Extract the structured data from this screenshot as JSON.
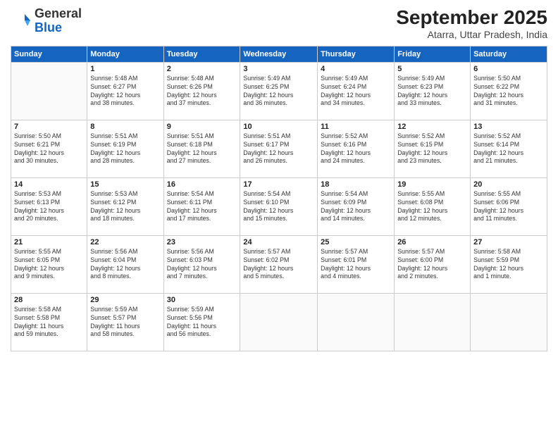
{
  "logo": {
    "text_general": "General",
    "text_blue": "Blue"
  },
  "title": "September 2025",
  "subtitle": "Atarra, Uttar Pradesh, India",
  "days_of_week": [
    "Sunday",
    "Monday",
    "Tuesday",
    "Wednesday",
    "Thursday",
    "Friday",
    "Saturday"
  ],
  "weeks": [
    [
      {
        "day": "",
        "info": ""
      },
      {
        "day": "1",
        "info": "Sunrise: 5:48 AM\nSunset: 6:27 PM\nDaylight: 12 hours\nand 38 minutes."
      },
      {
        "day": "2",
        "info": "Sunrise: 5:48 AM\nSunset: 6:26 PM\nDaylight: 12 hours\nand 37 minutes."
      },
      {
        "day": "3",
        "info": "Sunrise: 5:49 AM\nSunset: 6:25 PM\nDaylight: 12 hours\nand 36 minutes."
      },
      {
        "day": "4",
        "info": "Sunrise: 5:49 AM\nSunset: 6:24 PM\nDaylight: 12 hours\nand 34 minutes."
      },
      {
        "day": "5",
        "info": "Sunrise: 5:49 AM\nSunset: 6:23 PM\nDaylight: 12 hours\nand 33 minutes."
      },
      {
        "day": "6",
        "info": "Sunrise: 5:50 AM\nSunset: 6:22 PM\nDaylight: 12 hours\nand 31 minutes."
      }
    ],
    [
      {
        "day": "7",
        "info": "Sunrise: 5:50 AM\nSunset: 6:21 PM\nDaylight: 12 hours\nand 30 minutes."
      },
      {
        "day": "8",
        "info": "Sunrise: 5:51 AM\nSunset: 6:19 PM\nDaylight: 12 hours\nand 28 minutes."
      },
      {
        "day": "9",
        "info": "Sunrise: 5:51 AM\nSunset: 6:18 PM\nDaylight: 12 hours\nand 27 minutes."
      },
      {
        "day": "10",
        "info": "Sunrise: 5:51 AM\nSunset: 6:17 PM\nDaylight: 12 hours\nand 26 minutes."
      },
      {
        "day": "11",
        "info": "Sunrise: 5:52 AM\nSunset: 6:16 PM\nDaylight: 12 hours\nand 24 minutes."
      },
      {
        "day": "12",
        "info": "Sunrise: 5:52 AM\nSunset: 6:15 PM\nDaylight: 12 hours\nand 23 minutes."
      },
      {
        "day": "13",
        "info": "Sunrise: 5:52 AM\nSunset: 6:14 PM\nDaylight: 12 hours\nand 21 minutes."
      }
    ],
    [
      {
        "day": "14",
        "info": "Sunrise: 5:53 AM\nSunset: 6:13 PM\nDaylight: 12 hours\nand 20 minutes."
      },
      {
        "day": "15",
        "info": "Sunrise: 5:53 AM\nSunset: 6:12 PM\nDaylight: 12 hours\nand 18 minutes."
      },
      {
        "day": "16",
        "info": "Sunrise: 5:54 AM\nSunset: 6:11 PM\nDaylight: 12 hours\nand 17 minutes."
      },
      {
        "day": "17",
        "info": "Sunrise: 5:54 AM\nSunset: 6:10 PM\nDaylight: 12 hours\nand 15 minutes."
      },
      {
        "day": "18",
        "info": "Sunrise: 5:54 AM\nSunset: 6:09 PM\nDaylight: 12 hours\nand 14 minutes."
      },
      {
        "day": "19",
        "info": "Sunrise: 5:55 AM\nSunset: 6:08 PM\nDaylight: 12 hours\nand 12 minutes."
      },
      {
        "day": "20",
        "info": "Sunrise: 5:55 AM\nSunset: 6:06 PM\nDaylight: 12 hours\nand 11 minutes."
      }
    ],
    [
      {
        "day": "21",
        "info": "Sunrise: 5:55 AM\nSunset: 6:05 PM\nDaylight: 12 hours\nand 9 minutes."
      },
      {
        "day": "22",
        "info": "Sunrise: 5:56 AM\nSunset: 6:04 PM\nDaylight: 12 hours\nand 8 minutes."
      },
      {
        "day": "23",
        "info": "Sunrise: 5:56 AM\nSunset: 6:03 PM\nDaylight: 12 hours\nand 7 minutes."
      },
      {
        "day": "24",
        "info": "Sunrise: 5:57 AM\nSunset: 6:02 PM\nDaylight: 12 hours\nand 5 minutes."
      },
      {
        "day": "25",
        "info": "Sunrise: 5:57 AM\nSunset: 6:01 PM\nDaylight: 12 hours\nand 4 minutes."
      },
      {
        "day": "26",
        "info": "Sunrise: 5:57 AM\nSunset: 6:00 PM\nDaylight: 12 hours\nand 2 minutes."
      },
      {
        "day": "27",
        "info": "Sunrise: 5:58 AM\nSunset: 5:59 PM\nDaylight: 12 hours\nand 1 minute."
      }
    ],
    [
      {
        "day": "28",
        "info": "Sunrise: 5:58 AM\nSunset: 5:58 PM\nDaylight: 11 hours\nand 59 minutes."
      },
      {
        "day": "29",
        "info": "Sunrise: 5:59 AM\nSunset: 5:57 PM\nDaylight: 11 hours\nand 58 minutes."
      },
      {
        "day": "30",
        "info": "Sunrise: 5:59 AM\nSunset: 5:56 PM\nDaylight: 11 hours\nand 56 minutes."
      },
      {
        "day": "",
        "info": ""
      },
      {
        "day": "",
        "info": ""
      },
      {
        "day": "",
        "info": ""
      },
      {
        "day": "",
        "info": ""
      }
    ]
  ]
}
